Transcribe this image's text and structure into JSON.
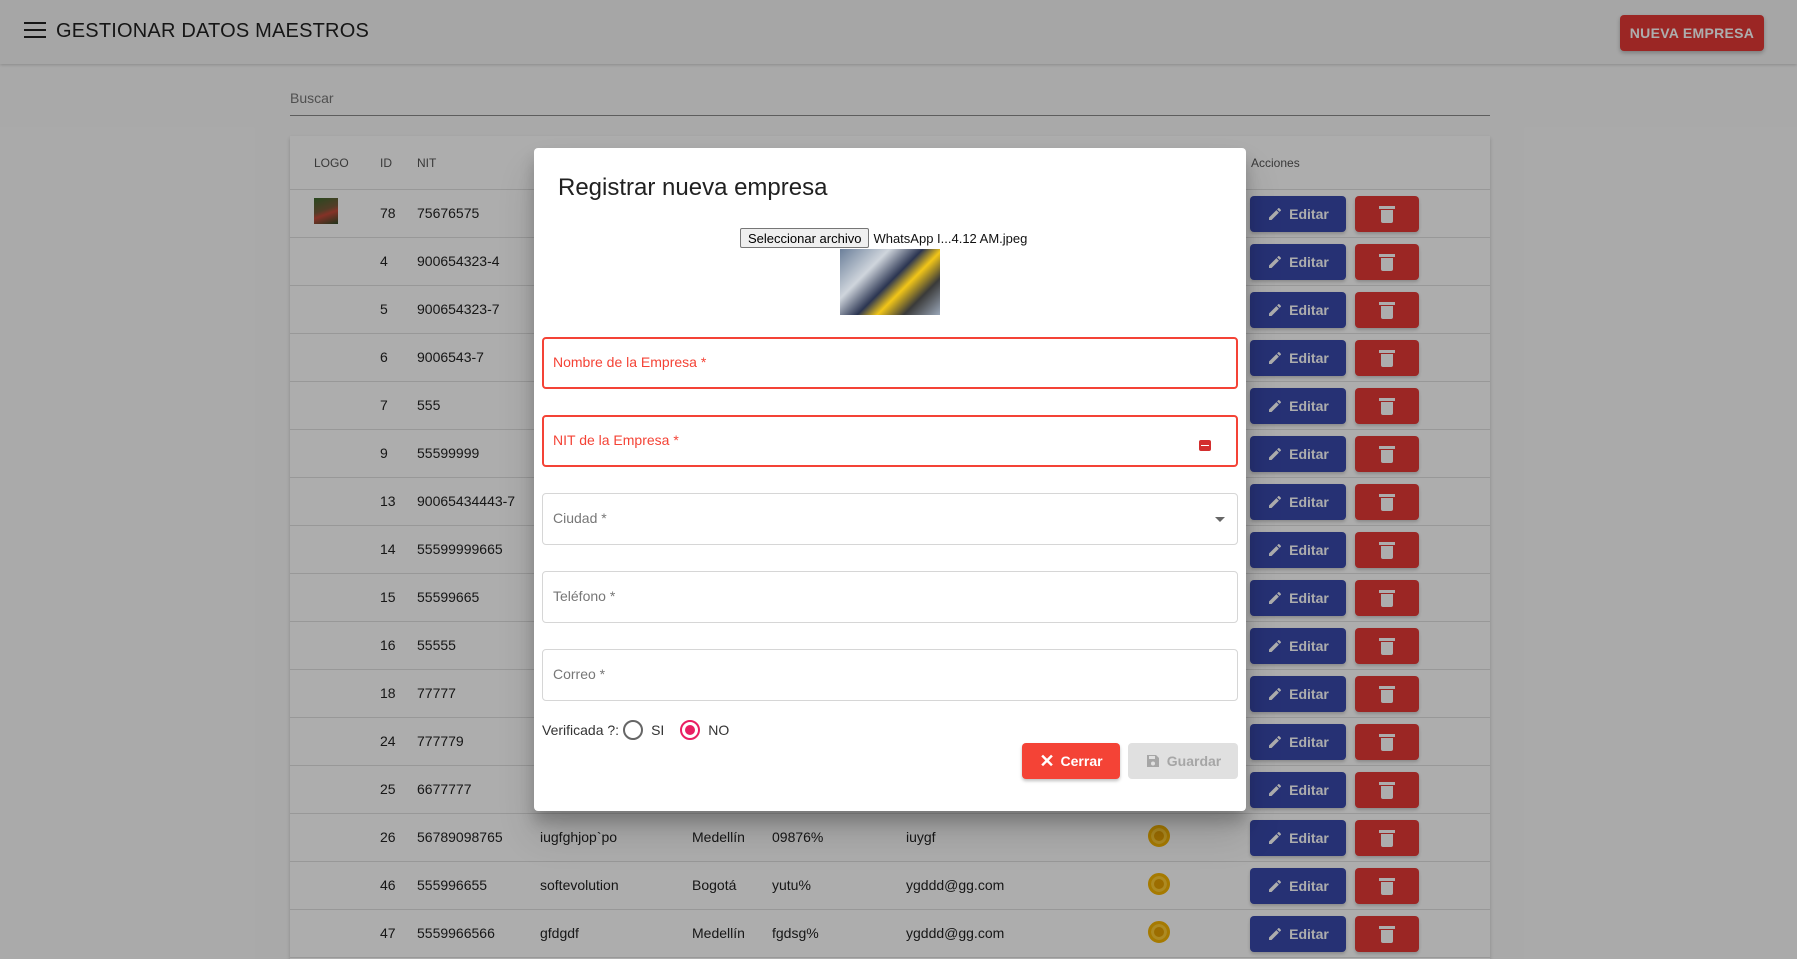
{
  "app": {
    "title": "GESTIONAR DATOS MAESTROS",
    "new_button": "NUEVA EMPRESA"
  },
  "search": {
    "placeholder": "Buscar"
  },
  "table": {
    "headers": {
      "logo": "LOGO",
      "id": "ID",
      "nit": "NIT",
      "actions": "Acciones"
    },
    "edit_label": "Editar",
    "rows": [
      {
        "id": "78",
        "nit": "75676575",
        "name": "",
        "city": "",
        "phone": "",
        "email": "",
        "has_logo": true,
        "status": false
      },
      {
        "id": "4",
        "nit": "900654323-4",
        "name": "",
        "city": "",
        "phone": "",
        "email": "",
        "has_logo": false,
        "status": false
      },
      {
        "id": "5",
        "nit": "900654323-7",
        "name": "",
        "city": "",
        "phone": "",
        "email": "",
        "has_logo": false,
        "status": false
      },
      {
        "id": "6",
        "nit": "9006543-7",
        "name": "",
        "city": "",
        "phone": "",
        "email": "",
        "has_logo": false,
        "status": false
      },
      {
        "id": "7",
        "nit": "555",
        "name": "",
        "city": "",
        "phone": "",
        "email": "",
        "has_logo": false,
        "status": false
      },
      {
        "id": "9",
        "nit": "55599999",
        "name": "",
        "city": "",
        "phone": "",
        "email": "",
        "has_logo": false,
        "status": false
      },
      {
        "id": "13",
        "nit": "90065434443-7",
        "name": "",
        "city": "",
        "phone": "",
        "email": "",
        "has_logo": false,
        "status": false
      },
      {
        "id": "14",
        "nit": "55599999665",
        "name": "",
        "city": "",
        "phone": "",
        "email": "",
        "has_logo": false,
        "status": false
      },
      {
        "id": "15",
        "nit": "55599665",
        "name": "",
        "city": "",
        "phone": "",
        "email": "",
        "has_logo": false,
        "status": false
      },
      {
        "id": "16",
        "nit": "55555",
        "name": "",
        "city": "",
        "phone": "",
        "email": "",
        "has_logo": false,
        "status": false
      },
      {
        "id": "18",
        "nit": "77777",
        "name": "",
        "city": "",
        "phone": "",
        "email": "",
        "has_logo": false,
        "status": false
      },
      {
        "id": "24",
        "nit": "777779",
        "name": "",
        "city": "",
        "phone": "",
        "email": "",
        "has_logo": false,
        "status": false
      },
      {
        "id": "25",
        "nit": "6677777",
        "name": "",
        "city": "",
        "phone": "",
        "email": "",
        "has_logo": false,
        "status": false
      },
      {
        "id": "26",
        "nit": "56789098765",
        "name": "iugfghjop`po",
        "city": "Medellín",
        "phone": "09876%",
        "email": "iuygf",
        "has_logo": false,
        "status": true
      },
      {
        "id": "46",
        "nit": "555996655",
        "name": "softevolution",
        "city": "Bogotá",
        "phone": "yutu%",
        "email": "ygddd@gg.com",
        "has_logo": false,
        "status": true
      },
      {
        "id": "47",
        "nit": "5559966566",
        "name": "gfdgdf",
        "city": "Medellín",
        "phone": "fgdsg%",
        "email": "ygddd@gg.com",
        "has_logo": false,
        "status": true
      }
    ]
  },
  "dialog": {
    "title": "Registrar nueva empresa",
    "file_button": "Seleccionar archivo",
    "file_name": "WhatsApp I...4.12 AM.jpeg",
    "fields": {
      "nombre": "Nombre de la Empresa *",
      "nit": "NIT de la Empresa *",
      "ciudad": "Ciudad *",
      "telefono": "Teléfono *",
      "correo": "Correo *"
    },
    "verified_label": "Verificada ?:",
    "option_si": "SI",
    "option_no": "NO",
    "selected": "NO",
    "close_button": "Cerrar",
    "save_button": "Guardar"
  },
  "colors": {
    "primary": "#3949ab",
    "danger": "#e53935",
    "error": "#f44336",
    "radio_accent": "#e91e63",
    "status": "#f5b400"
  }
}
